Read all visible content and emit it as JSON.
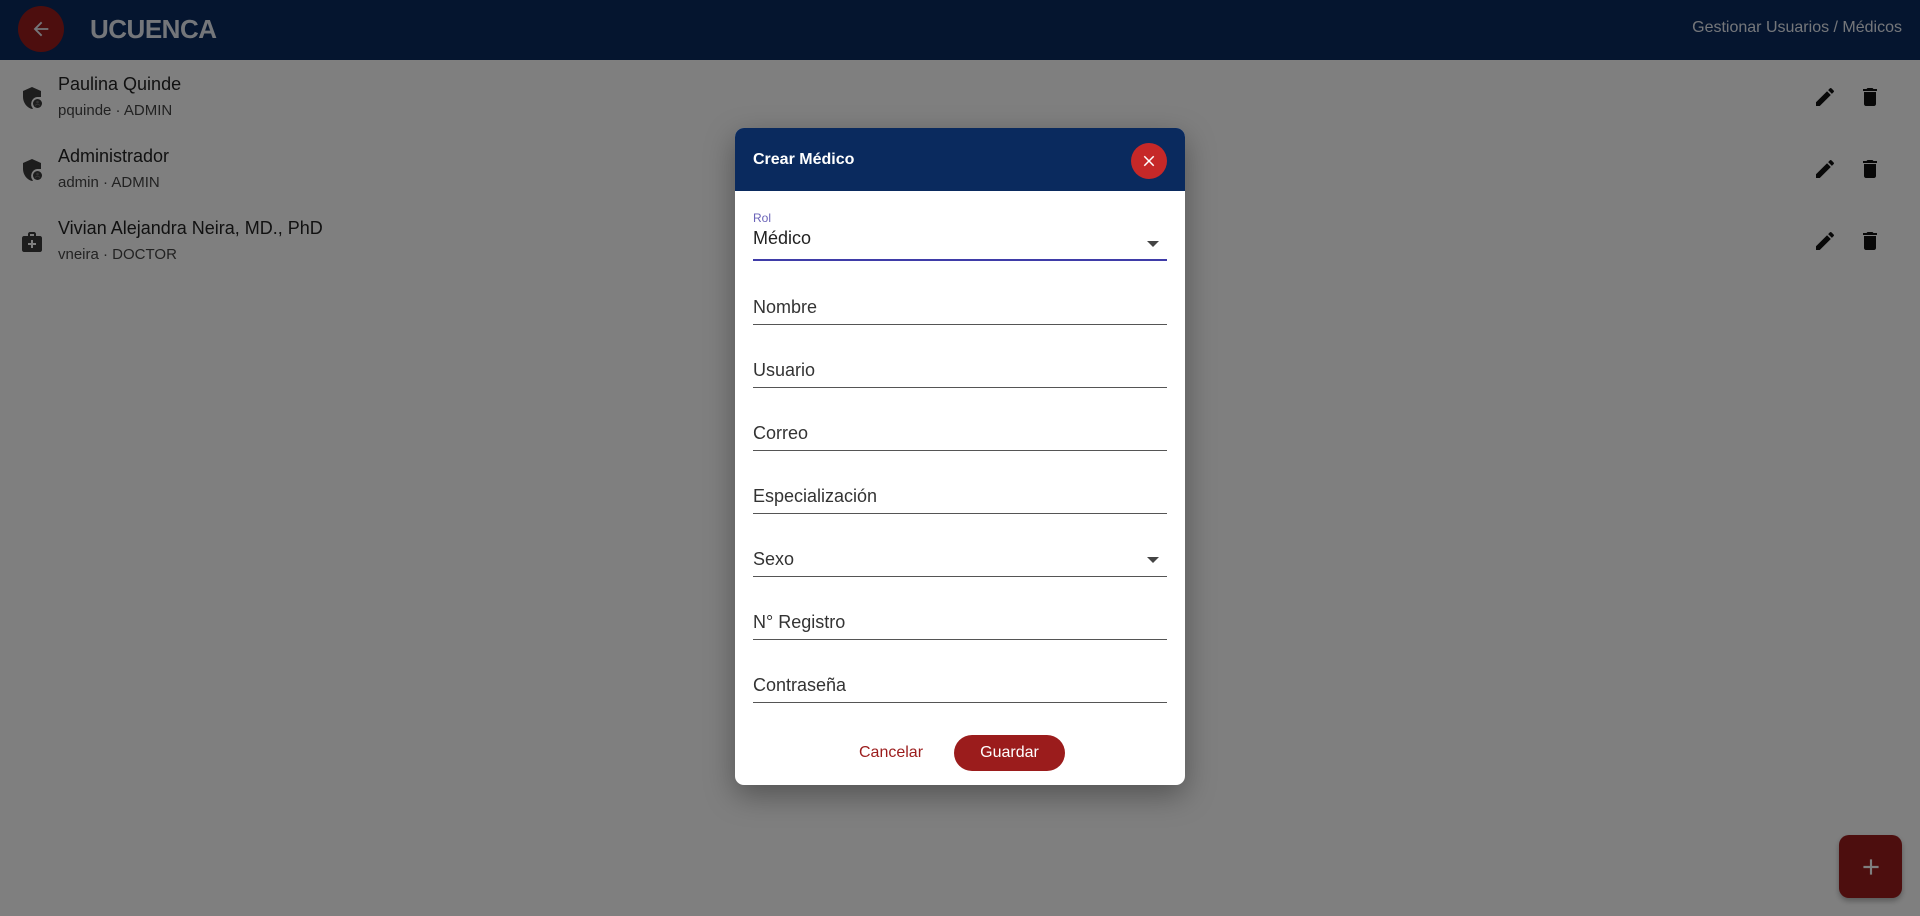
{
  "appbar": {
    "brand": "UCUENCA",
    "breadcrumb": "Gestionar Usuarios / Médicos",
    "back_icon": "arrow-left-icon"
  },
  "users": [
    {
      "name": "Paulina Quinde",
      "subtitle": "pquinde · ADMIN",
      "icon": "admin-shield-icon"
    },
    {
      "name": "Administrador",
      "subtitle": "admin · ADMIN",
      "icon": "admin-shield-icon"
    },
    {
      "name": "Vivian Alejandra Neira, MD., PhD",
      "subtitle": "vneira · DOCTOR",
      "icon": "medical-bag-icon"
    }
  ],
  "dialog": {
    "title": "Crear Médico",
    "rol": {
      "label": "Rol",
      "value": "Médico"
    },
    "fields": {
      "nombre": "Nombre",
      "usuario": "Usuario",
      "correo": "Correo",
      "especializacion": "Especialización",
      "sexo": "Sexo",
      "registro": "N° Registro",
      "contrasena": "Contraseña"
    },
    "cancel_label": "Cancelar",
    "save_label": "Guardar"
  },
  "colors": {
    "primary": "#0a2a5e",
    "accent": "#9b1c1c",
    "close": "#c62828",
    "focus": "#3f3ca8"
  }
}
